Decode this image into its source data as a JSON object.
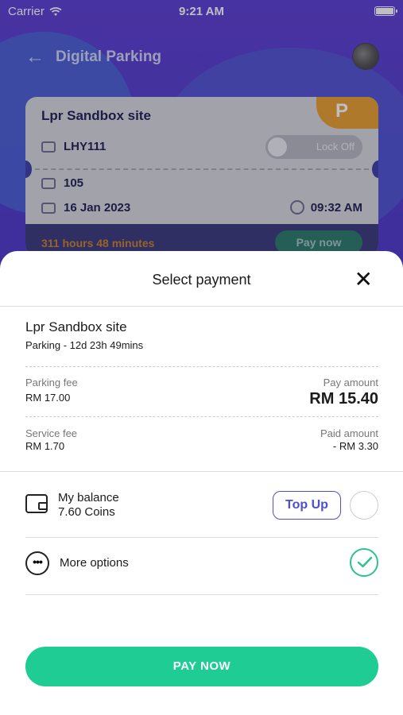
{
  "status_bar": {
    "carrier": "Carrier",
    "time": "9:21 AM"
  },
  "header": {
    "title": "Digital Parking"
  },
  "ticket": {
    "site": "Lpr Sandbox site",
    "badge": "P",
    "plate": "LHY111",
    "lock_label": "Lock Off",
    "bay": "105",
    "date": "16 Jan 2023",
    "time": "09:32 AM",
    "duration": "311 hours 48 minutes",
    "pay_label": "Pay now"
  },
  "sheet": {
    "title": "Select payment",
    "site": "Lpr Sandbox site",
    "subtitle": "Parking - 12d 23h 49mins",
    "parking_fee_label": "Parking fee",
    "parking_fee_value": "RM 17.00",
    "pay_amount_label": "Pay amount",
    "pay_amount_value": "RM 15.40",
    "service_fee_label": "Service fee",
    "service_fee_value": "RM 1.70",
    "paid_amount_label": "Paid amount",
    "paid_amount_value": "- RM 3.30",
    "balance_label": "My balance",
    "balance_value": "7.60 Coins",
    "topup_label": "Top Up",
    "more_label": "More options",
    "more_selected": true,
    "pay_button": "PAY NOW"
  },
  "colors": {
    "accent": "#1fcc94",
    "primary": "#4b4fd0",
    "badge": "#e9a02d"
  }
}
